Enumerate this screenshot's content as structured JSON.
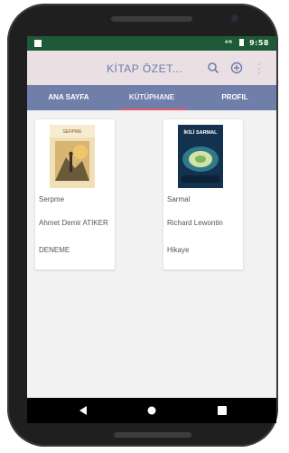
{
  "status": {
    "signal": "⁴ᴳ",
    "time": "9:58"
  },
  "appbar": {
    "title": "KİTAP ÖZET...",
    "icons": [
      "search-icon",
      "add-circle-icon",
      "more-vert-icon"
    ]
  },
  "tabs": [
    {
      "label": "ANA SAYFA",
      "selected": false
    },
    {
      "label": "KÜTÜPHANE",
      "selected": true
    },
    {
      "label": "PROFIL",
      "selected": false
    }
  ],
  "books": [
    {
      "title": "Serpme",
      "author": "Ahmet Demir ATIKER",
      "genre": "DENEME",
      "cover_text": "SERPME"
    },
    {
      "title": "Sarmal",
      "author": "Richard Lewontin",
      "genre": "Hikaye",
      "cover_text": "İKİLİ SARMAL"
    }
  ],
  "colors": {
    "statusbar": "#1e5a36",
    "appbar": "#eadfe3",
    "tabs": "#6f7fa9",
    "indicator": "#e55a6a"
  }
}
